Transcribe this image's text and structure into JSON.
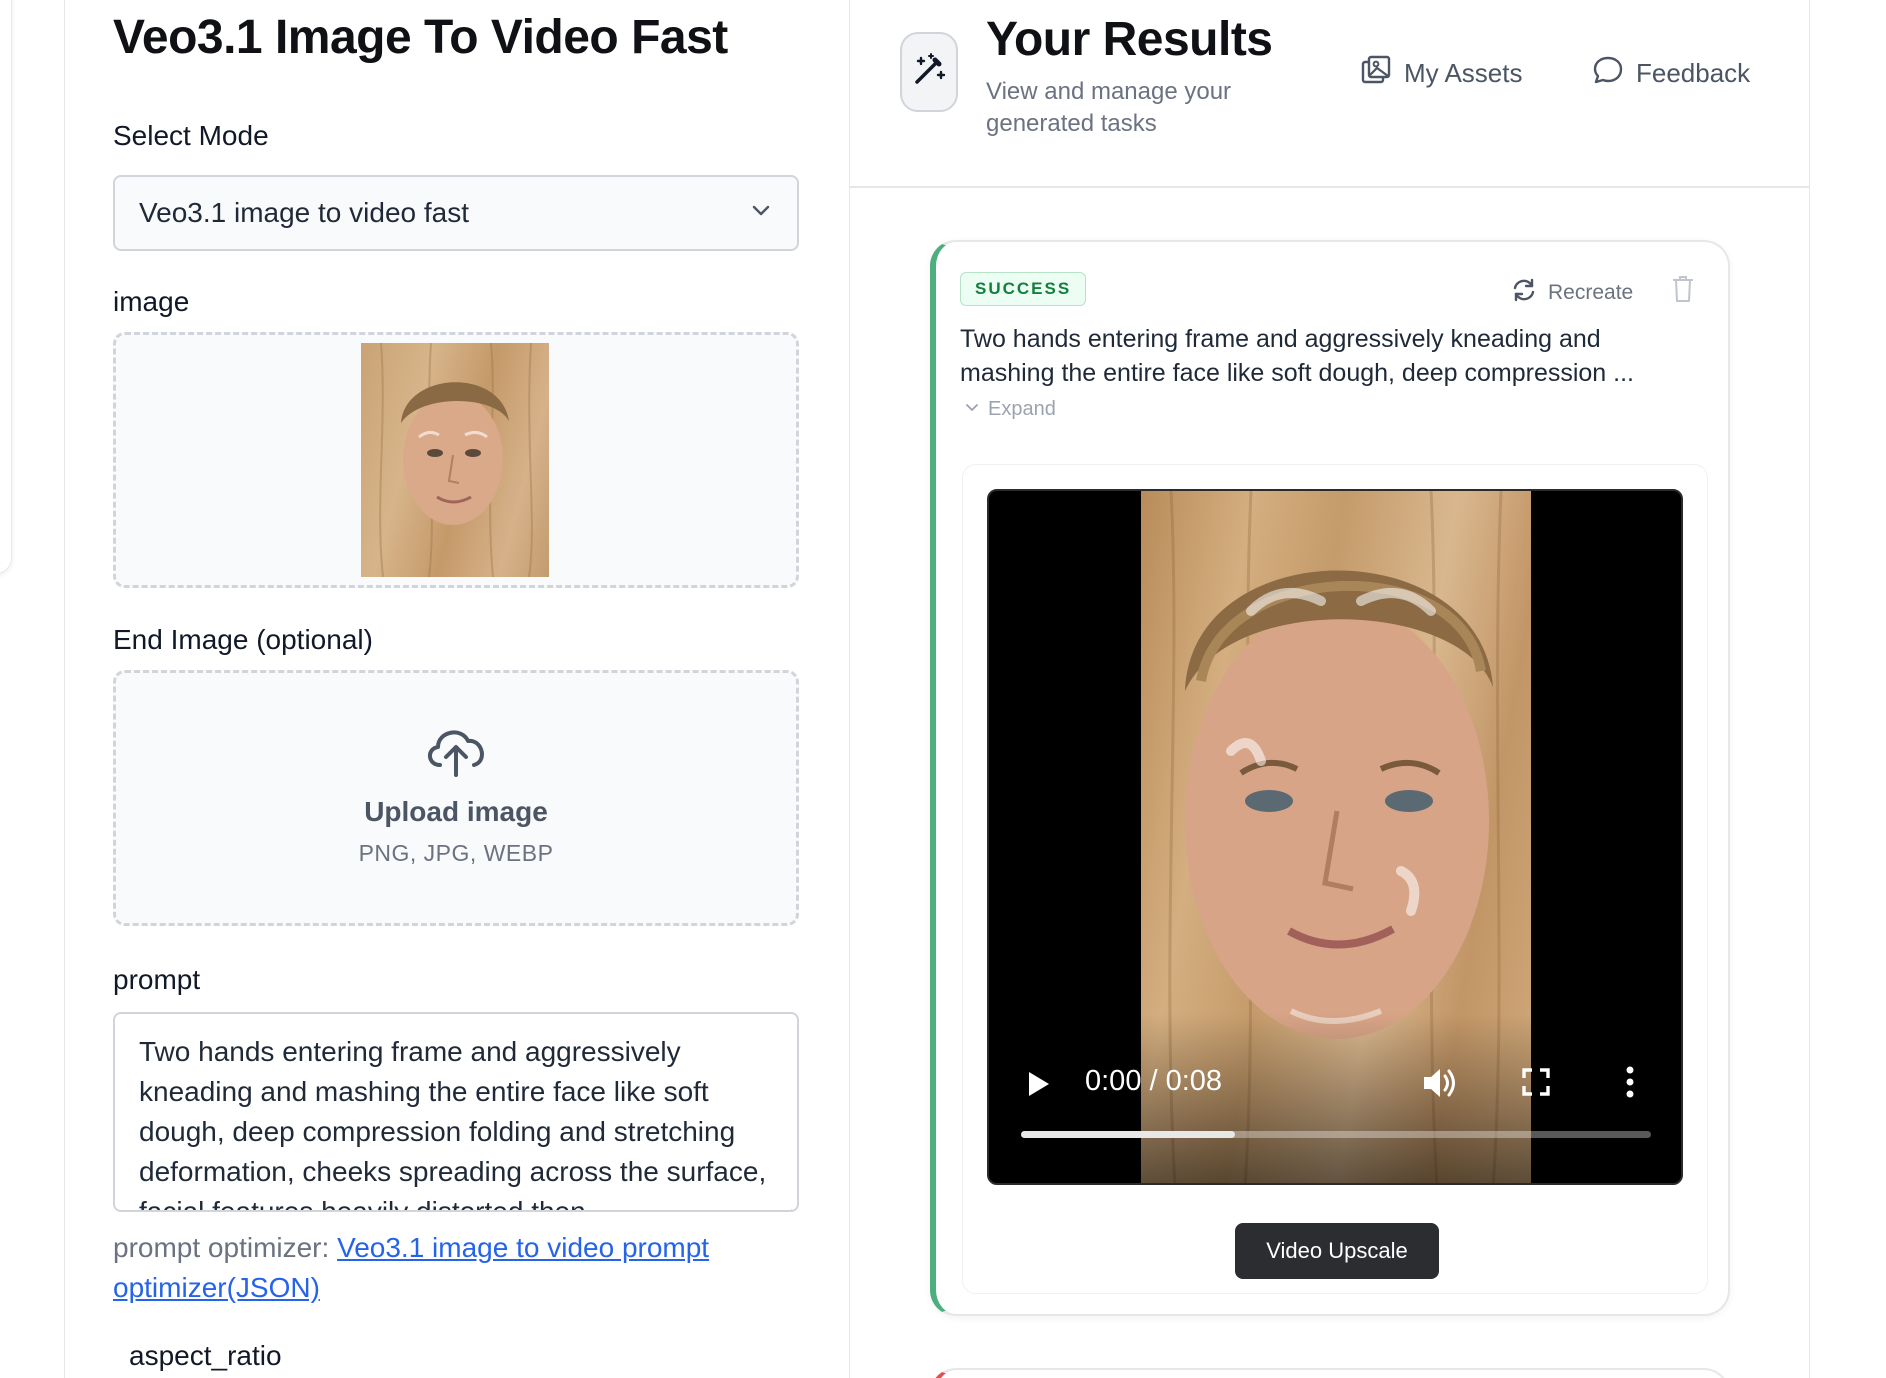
{
  "form": {
    "title": "Veo3.1 Image To Video Fast",
    "mode_label": "Select Mode",
    "mode_value": "Veo3.1 image to video fast",
    "image_label": "image",
    "end_image_label": "End Image (optional)",
    "upload_title": "Upload image",
    "upload_formats": "PNG, JPG, WEBP",
    "prompt_label": "prompt",
    "prompt_value": "Two hands entering frame and aggressively kneading and mashing the entire face like soft dough, deep compression folding and stretching deformation, cheeks spreading across the surface, facial features heavily distorted then",
    "optimizer_prefix": "prompt optimizer: ",
    "optimizer_link": "Veo3.1 image to video prompt optimizer(JSON)",
    "aspect_label": "aspect_ratio"
  },
  "results": {
    "title": "Your Results",
    "subtitle": "View and manage your generated tasks",
    "my_assets": "My Assets",
    "feedback": "Feedback",
    "task": {
      "status": "SUCCESS",
      "status_color": "#15803d",
      "recreate": "Recreate",
      "prompt_preview": "Two hands entering frame and aggressively kneading and mashing the entire face like soft dough, deep compression ...",
      "expand": "Expand",
      "video_time": "0:00 / 0:08",
      "progress_fraction": 0.34,
      "upscale": "Video Upscale"
    }
  },
  "colors": {
    "success_accent": "#4caf7d",
    "error_accent": "#e05252",
    "link": "#2563eb"
  }
}
